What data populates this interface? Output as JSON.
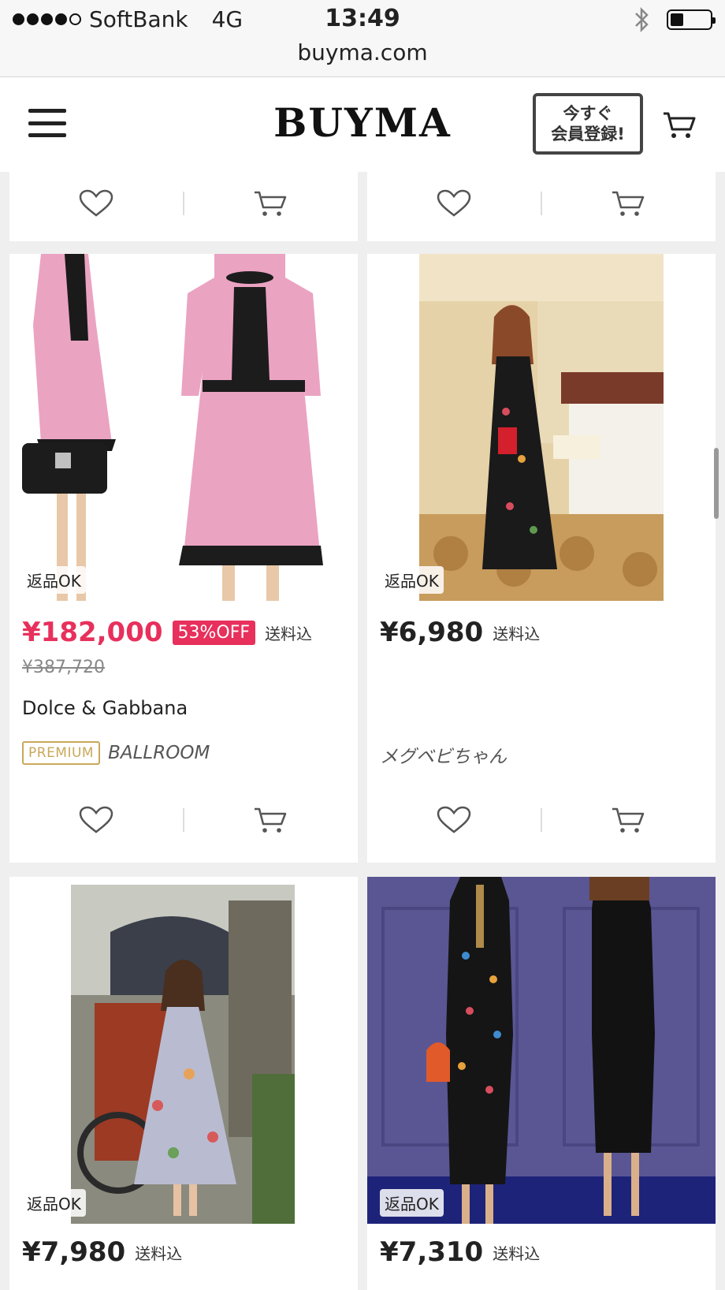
{
  "status_bar": {
    "carrier": "SoftBank",
    "network": "4G",
    "time": "13:49",
    "url": "buyma.com"
  },
  "header": {
    "logo": "BUYMA",
    "register_line1": "今すぐ",
    "register_line2": "会員登録!"
  },
  "products": [
    {
      "return_badge": "返品OK",
      "price": "¥182,000",
      "discount": "53%OFF",
      "shipping": "送料込",
      "original_price": "¥387,720",
      "brand": "Dolce & Gabbana",
      "seller_badge": "PREMIUM",
      "seller": "BALLROOM"
    },
    {
      "return_badge": "返品OK",
      "price": "¥6,980",
      "shipping": "送料込",
      "seller": "メグベビちゃん"
    },
    {
      "return_badge": "返品OK",
      "price": "¥7,980",
      "shipping": "送料込"
    },
    {
      "return_badge": "返品OK",
      "price": "¥7,310",
      "shipping": "送料込"
    }
  ],
  "colors": {
    "sale_pink": "#e8305c",
    "premium_gold": "#c9a85a",
    "page_bg": "#efefef"
  },
  "icons": [
    "hamburger-icon",
    "cart-icon",
    "heart-icon",
    "bluetooth-icon",
    "battery-icon"
  ]
}
